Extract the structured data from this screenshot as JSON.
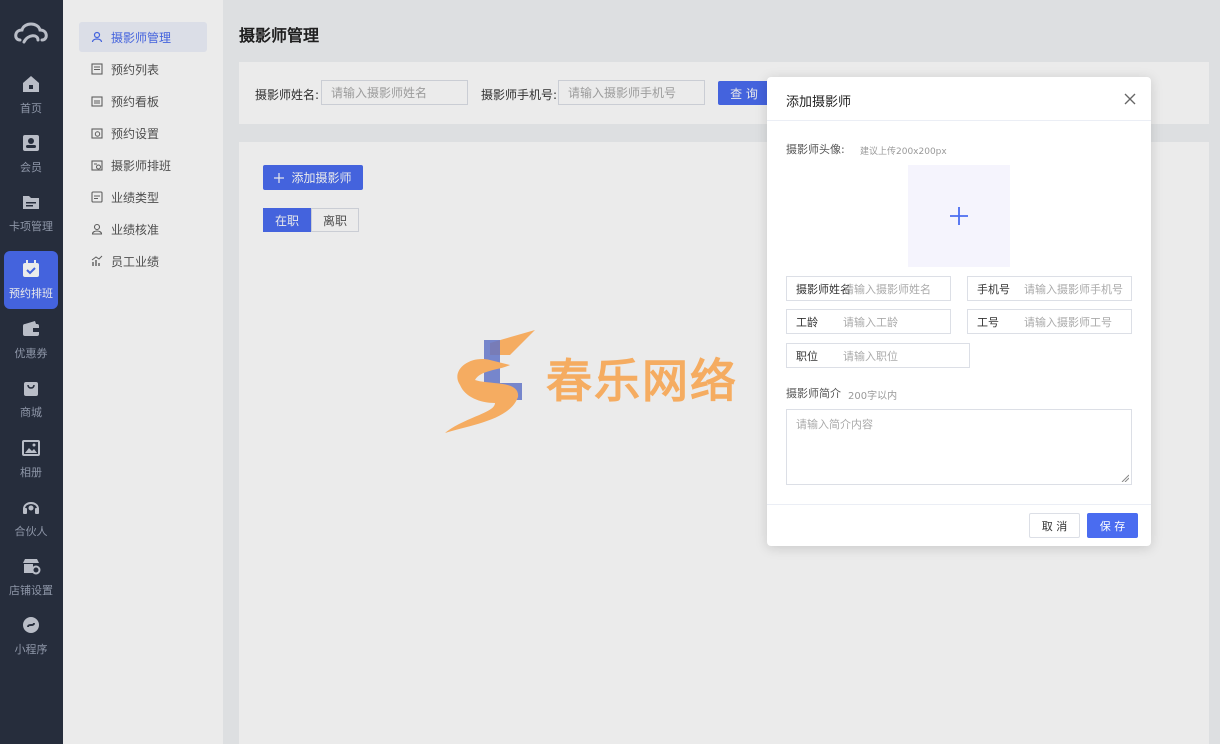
{
  "rail": {
    "items": [
      {
        "label": "首页",
        "icon": "home-icon"
      },
      {
        "label": "会员",
        "icon": "member-card-icon"
      },
      {
        "label": "卡项管理",
        "icon": "folder-icon"
      },
      {
        "label": "预约排班",
        "icon": "calendar-check-icon",
        "active": true
      },
      {
        "label": "优惠券",
        "icon": "wallet-icon"
      },
      {
        "label": "商城",
        "icon": "shopping-bag-icon"
      },
      {
        "label": "相册",
        "icon": "image-icon"
      },
      {
        "label": "合伙人",
        "icon": "headset-icon"
      },
      {
        "label": "店铺设置",
        "icon": "store-settings-icon"
      },
      {
        "label": "小程序",
        "icon": "mini-program-icon"
      }
    ]
  },
  "submenu": {
    "items": [
      {
        "label": "摄影师管理",
        "active": true
      },
      {
        "label": "预约列表"
      },
      {
        "label": "预约看板"
      },
      {
        "label": "预约设置"
      },
      {
        "label": "摄影师排班"
      },
      {
        "label": "业绩类型"
      },
      {
        "label": "业绩核准"
      },
      {
        "label": "员工业绩"
      }
    ]
  },
  "main": {
    "title": "摄影师管理",
    "filters": {
      "name_label": "摄影师姓名:",
      "name_placeholder": "请输入摄影师姓名",
      "phone_label": "摄影师手机号:",
      "phone_placeholder": "请输入摄影师手机号",
      "search_button": "查 询"
    },
    "add_button": "添加摄影师",
    "tabs": [
      "在职",
      "离职"
    ]
  },
  "watermark": {
    "text": "春乐网络"
  },
  "modal": {
    "title": "添加摄影师",
    "avatar_label": "摄影师头像:",
    "avatar_hint": "建议上传200x200px",
    "fields": {
      "name": {
        "label": "摄影师姓名",
        "placeholder": "请输入摄影师姓名"
      },
      "phone": {
        "label": "手机号",
        "placeholder": "请输入摄影师手机号"
      },
      "seniority": {
        "label": "工龄",
        "placeholder": "请输入工龄"
      },
      "employee_no": {
        "label": "工号",
        "placeholder": "请输入摄影师工号"
      },
      "position": {
        "label": "职位",
        "placeholder": "请输入职位"
      }
    },
    "intro_label": "摄影师简介",
    "intro_hint": "200字以内",
    "intro_placeholder": "请输入简介内容",
    "cancel_button": "取 消",
    "save_button": "保 存"
  },
  "colors": {
    "primary": "#4a6cf0",
    "rail_bg": "#2a3142",
    "watermark_orange": "#f7a24a",
    "watermark_blue": "#4a5fc1"
  }
}
